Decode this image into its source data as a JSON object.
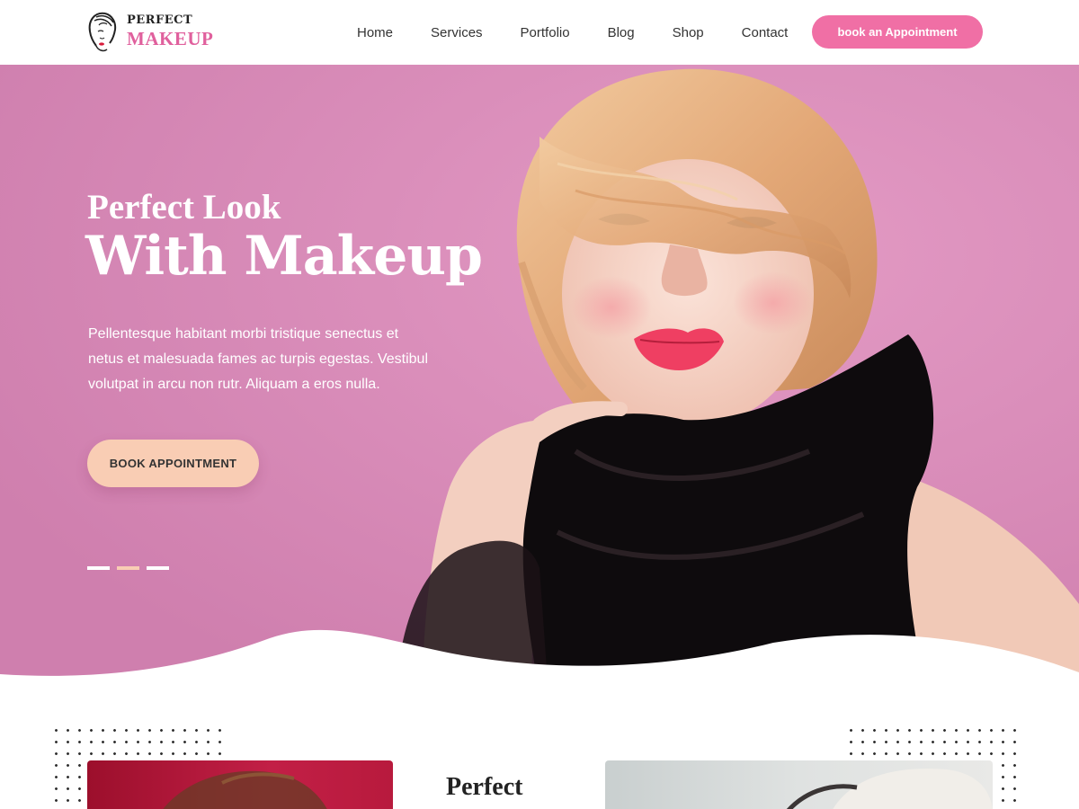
{
  "brand": {
    "top": "PERFECT",
    "bottom": "MAKEUP",
    "accent_color": "#e0609d"
  },
  "nav": {
    "items": [
      {
        "label": "Home"
      },
      {
        "label": "Services"
      },
      {
        "label": "Portfolio"
      },
      {
        "label": "Blog"
      },
      {
        "label": "Shop"
      },
      {
        "label": "Contact"
      }
    ],
    "cta_label": "book an Appointment",
    "cta_color": "#f06fa5"
  },
  "hero": {
    "title_line1": "Perfect Look",
    "title_line2": "With Makeup",
    "description": "Pellentesque habitant morbi tristique senectus et netus et malesuada fames ac turpis egestas. Vestibul volutpat in arcu non rutr. Aliquam a eros nulla.",
    "button_label": "BOOK APPOINTMENT",
    "background_color": "#d98ab7",
    "button_color": "#f9cdb4",
    "slides": [
      {
        "active": false
      },
      {
        "active": true
      },
      {
        "active": false
      }
    ]
  },
  "section": {
    "title": "Perfect"
  }
}
